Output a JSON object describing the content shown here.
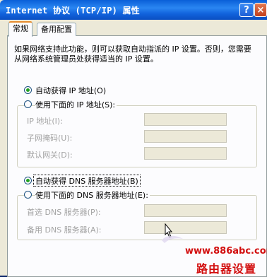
{
  "window": {
    "title": "Internet 协议 (TCP/IP) 属性",
    "help_label": "?",
    "close_label": "×"
  },
  "tabs": [
    {
      "label": "常规"
    },
    {
      "label": "备用配置"
    }
  ],
  "intro_text": "如果网络支持此功能，则可以获取自动指派的 IP 设置。否则，您需要从网络系统管理员处获得适当的 IP 设置。",
  "ip_section": {
    "auto_label": "自动获得 IP 地址(O)",
    "manual_label": "使用下面的 IP 地址(S):",
    "auto_selected": true,
    "fields": [
      {
        "label": "IP 地址(I):",
        "value": ""
      },
      {
        "label": "子网掩码(U):",
        "value": ""
      },
      {
        "label": "默认网关(D):",
        "value": ""
      }
    ]
  },
  "dns_section": {
    "auto_label": "自动获得 DNS 服务器地址(B)",
    "manual_label": "使用下面的 DNS 服务器地址(E):",
    "auto_selected": true,
    "fields": [
      {
        "label": "首选 DNS 服务器(P):",
        "value": ""
      },
      {
        "label": "备用 DNS 服务器(A):",
        "value": ""
      }
    ]
  },
  "watermark": {
    "url": "www.886abc.com",
    "caption": "路由器设置"
  },
  "colors": {
    "titlebar": "#1162dc",
    "dialog_bg": "#ece9d8",
    "watermark": "#d20d0d",
    "radio_dot": "#21a121"
  }
}
